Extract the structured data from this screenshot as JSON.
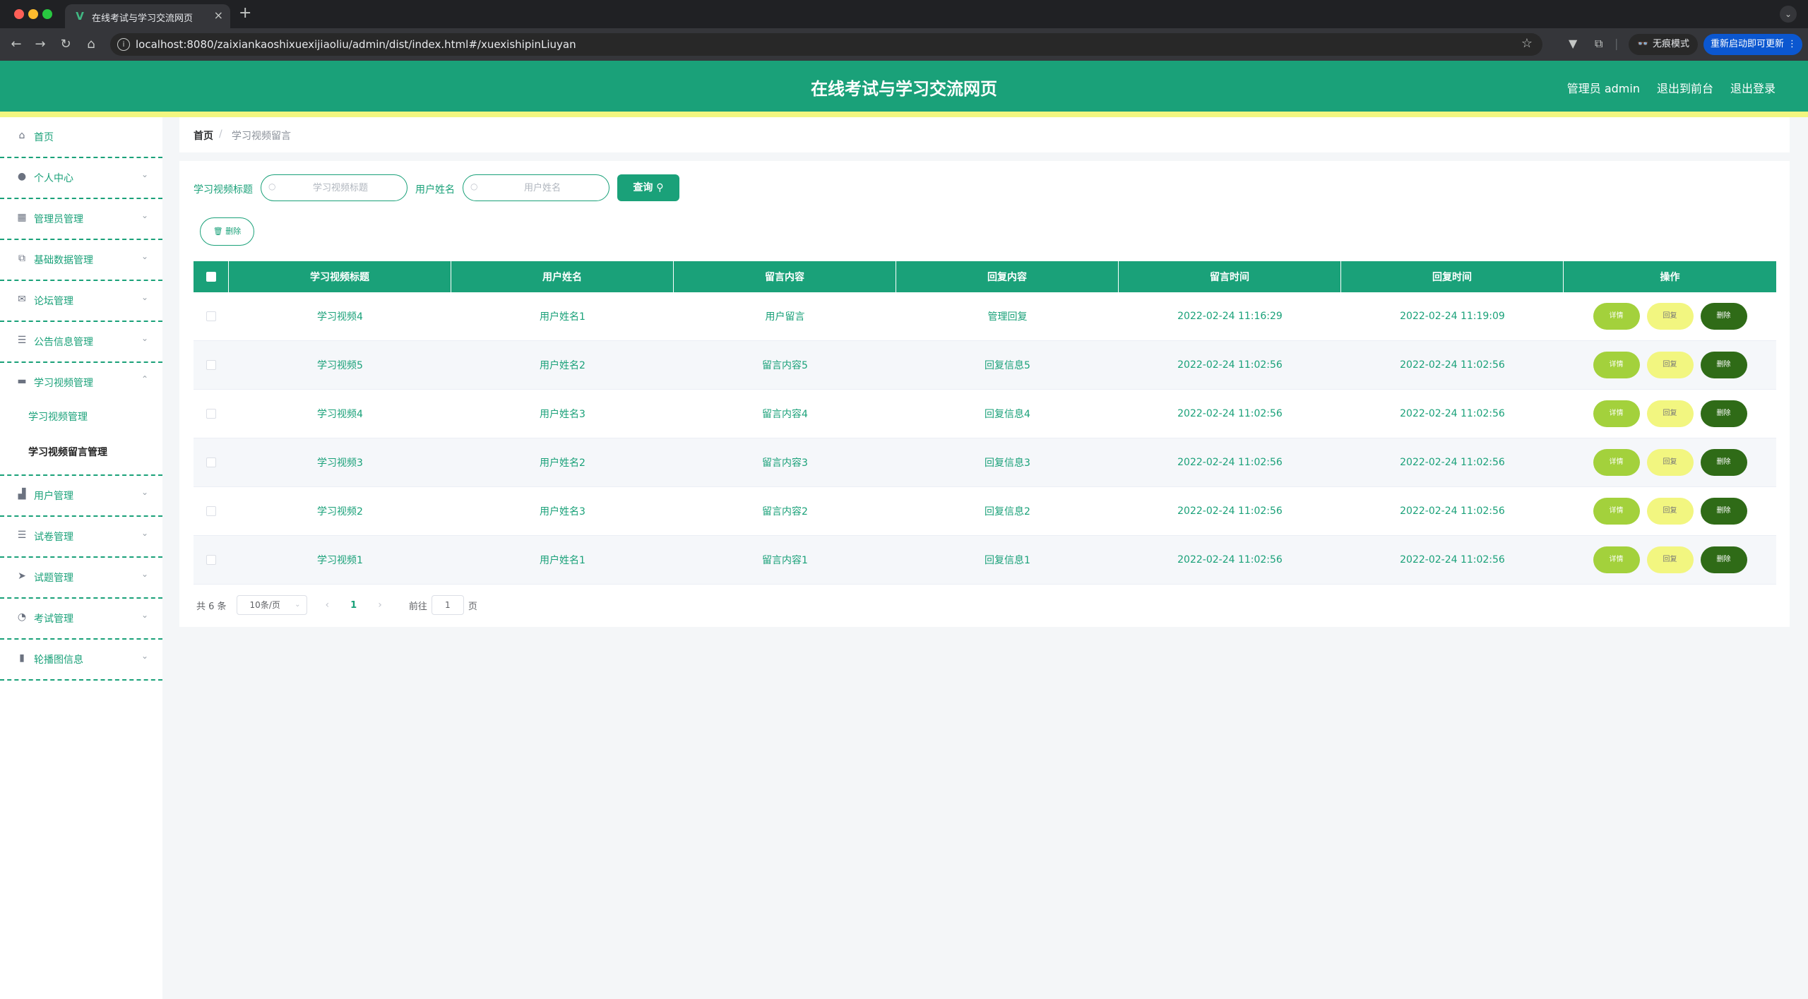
{
  "browser": {
    "tab_title": "在线考试与学习交流网页",
    "url": "localhost:8080/zaixiankaoshixuexijiaoliu/admin/dist/index.html#/xuexishipinLiuyan",
    "incognito_label": "无痕模式",
    "update_label": "重新启动即可更新"
  },
  "header": {
    "title": "在线考试与学习交流网页",
    "user_label": "管理员 admin",
    "to_front_label": "退出到前台",
    "logout_label": "退出登录"
  },
  "sidebar": {
    "items": [
      {
        "label": "首页",
        "icon": "home-icon"
      },
      {
        "label": "个人中心",
        "icon": "user-icon"
      },
      {
        "label": "管理员管理",
        "icon": "grid-icon"
      },
      {
        "label": "基础数据管理",
        "icon": "copy-icon"
      },
      {
        "label": "论坛管理",
        "icon": "mail-icon"
      },
      {
        "label": "公告信息管理",
        "icon": "list-icon"
      },
      {
        "label": "学习视频管理",
        "icon": "monitor-icon"
      },
      {
        "label": "用户管理",
        "icon": "thumb-icon"
      },
      {
        "label": "试卷管理",
        "icon": "list-icon"
      },
      {
        "label": "试题管理",
        "icon": "send-icon"
      },
      {
        "label": "考试管理",
        "icon": "clock-icon"
      },
      {
        "label": "轮播图信息",
        "icon": "chart-icon"
      }
    ],
    "submenu": [
      "学习视频管理",
      "学习视频留言管理"
    ]
  },
  "breadcrumb": {
    "home": "首页",
    "separator": "/",
    "current": "学习视频留言"
  },
  "search": {
    "title_label": "学习视频标题",
    "title_placeholder": "学习视频标题",
    "user_label": "用户姓名",
    "user_placeholder": "用户姓名",
    "query_label": "查询"
  },
  "toolbar": {
    "delete_label": "删除"
  },
  "table": {
    "columns": [
      "学习视频标题",
      "用户姓名",
      "留言内容",
      "回复内容",
      "留言时间",
      "回复时间",
      "操作"
    ],
    "rows": [
      {
        "title": "学习视频4",
        "user": "用户姓名1",
        "content": "用户留言",
        "reply": "管理回复",
        "created": "2022-02-24 11:16:29",
        "replied": "2022-02-24 11:19:09"
      },
      {
        "title": "学习视频5",
        "user": "用户姓名2",
        "content": "留言内容5",
        "reply": "回复信息5",
        "created": "2022-02-24 11:02:56",
        "replied": "2022-02-24 11:02:56"
      },
      {
        "title": "学习视频4",
        "user": "用户姓名3",
        "content": "留言内容4",
        "reply": "回复信息4",
        "created": "2022-02-24 11:02:56",
        "replied": "2022-02-24 11:02:56"
      },
      {
        "title": "学习视频3",
        "user": "用户姓名2",
        "content": "留言内容3",
        "reply": "回复信息3",
        "created": "2022-02-24 11:02:56",
        "replied": "2022-02-24 11:02:56"
      },
      {
        "title": "学习视频2",
        "user": "用户姓名3",
        "content": "留言内容2",
        "reply": "回复信息2",
        "created": "2022-02-24 11:02:56",
        "replied": "2022-02-24 11:02:56"
      },
      {
        "title": "学习视频1",
        "user": "用户姓名1",
        "content": "留言内容1",
        "reply": "回复信息1",
        "created": "2022-02-24 11:02:56",
        "replied": "2022-02-24 11:02:56"
      }
    ],
    "actions": {
      "detail": "详情",
      "reply": "回复",
      "delete": "删除"
    }
  },
  "pagination": {
    "total": "共 6 条",
    "page_size": "10条/页",
    "current_page": "1",
    "goto_label": "前往",
    "goto_value": "1",
    "page_unit": "页"
  },
  "colors": {
    "primary": "#1aa179",
    "accent_yellow": "#f2f680",
    "detail_green": "#a3d13c",
    "delete_dark": "#2f6b17"
  }
}
